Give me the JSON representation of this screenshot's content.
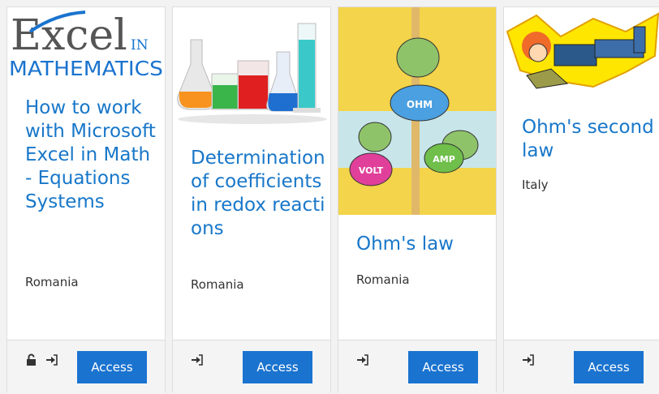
{
  "courses": [
    {
      "logo_main": "Excel",
      "logo_in": "IN",
      "logo_sub": "MATHEMATICS",
      "title": "How to work with Microsoft Excel in Math - Equations Systems",
      "country": "Romania",
      "action_label": "Access",
      "icons": [
        "unlock-icon",
        "sign-in-icon"
      ]
    },
    {
      "title": "Determination of coefficients in redox reactions",
      "country": "Romania",
      "action_label": "Access",
      "icons": [
        "sign-in-icon"
      ]
    },
    {
      "image_label_top": "OHM",
      "image_label_left": "VOLT",
      "image_label_right": "AMP",
      "title": "Ohm's law",
      "country": "Romania",
      "action_label": "Access",
      "icons": [
        "sign-in-icon"
      ]
    },
    {
      "title": "Ohm's second law",
      "country": "Italy",
      "action_label": "Access",
      "icons": [
        "sign-in-icon"
      ]
    }
  ],
  "colors": {
    "accent": "#1877c9",
    "button": "#1a73cf"
  }
}
